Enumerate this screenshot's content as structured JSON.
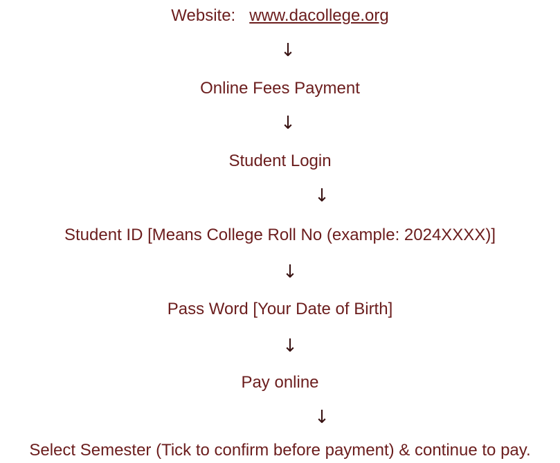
{
  "steps": {
    "website_label": "Website:",
    "website_link": "www.dacollege.org",
    "online_fees_payment": "Online Fees Payment",
    "student_login": "Student Login",
    "student_id": "Student ID  [Means College Roll No (example: 2024XXXX)]",
    "password": "Pass Word [Your Date of Birth]",
    "pay_online": "Pay online",
    "select_semester": "Select Semester (Tick to confirm before payment) & continue to pay."
  },
  "arrow_symbol": "↓",
  "colors": {
    "text": "#6b1d1d",
    "arrow": "#3a1414",
    "background": "#ffffff"
  }
}
